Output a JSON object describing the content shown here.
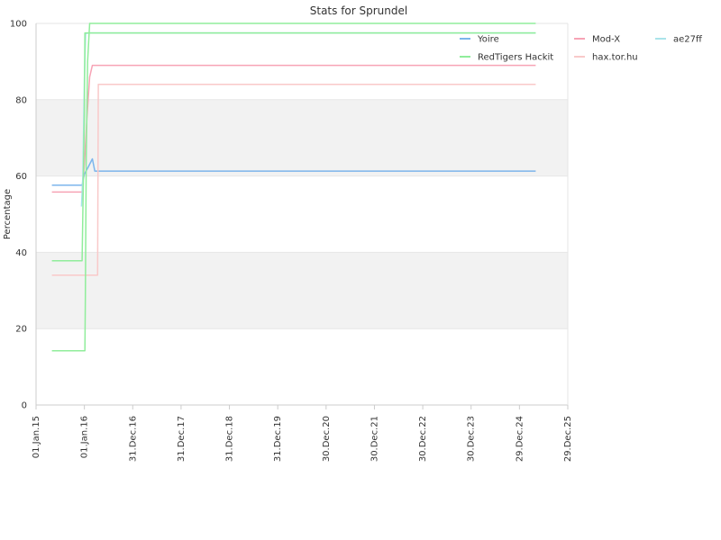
{
  "chart_data": {
    "type": "line",
    "title": "Stats for Sprundel",
    "xlabel": "",
    "ylabel": "Percentage",
    "x_type": "date",
    "xlim": [
      "2015-01-01",
      "2025-12-29"
    ],
    "ylim": [
      0,
      100
    ],
    "y_ticks": [
      0,
      20,
      40,
      60,
      80,
      100
    ],
    "x_ticks": [
      {
        "date": "2015-01-01",
        "label": "01.Jan.15"
      },
      {
        "date": "2016-01-01",
        "label": "01.Jan.16"
      },
      {
        "date": "2016-12-31",
        "label": "31.Dec.16"
      },
      {
        "date": "2017-12-31",
        "label": "31.Dec.17"
      },
      {
        "date": "2018-12-31",
        "label": "31.Dec.18"
      },
      {
        "date": "2019-12-31",
        "label": "31.Dec.19"
      },
      {
        "date": "2020-12-30",
        "label": "30.Dec.20"
      },
      {
        "date": "2021-12-30",
        "label": "30.Dec.21"
      },
      {
        "date": "2022-12-30",
        "label": "30.Dec.22"
      },
      {
        "date": "2023-12-30",
        "label": "30.Dec.23"
      },
      {
        "date": "2024-12-29",
        "label": "29.Dec.24"
      },
      {
        "date": "2025-12-29",
        "label": "29.Dec.25"
      }
    ],
    "grid": true,
    "alternating_bands": true,
    "legend_position": "top-right",
    "series": [
      {
        "name": "Yoire",
        "color": "#7cb5ec",
        "points": [
          [
            "2015-05-01",
            57.6
          ],
          [
            "2015-12-15",
            57.6
          ],
          [
            "2016-01-01",
            60.5
          ],
          [
            "2016-02-01",
            62.5
          ],
          [
            "2016-03-01",
            64.5
          ],
          [
            "2016-03-20",
            61.3
          ],
          [
            "2025-05-01",
            61.3
          ]
        ]
      },
      {
        "name": "Mod-X",
        "color": "#f7a3b5",
        "points": [
          [
            "2015-05-01",
            55.8
          ],
          [
            "2015-12-15",
            55.8
          ],
          [
            "2016-01-01",
            63
          ],
          [
            "2016-01-20",
            75
          ],
          [
            "2016-02-10",
            86
          ],
          [
            "2016-03-01",
            89
          ],
          [
            "2025-05-01",
            89
          ]
        ]
      },
      {
        "name": "ae27ff",
        "color": "#a9e4ea",
        "points": [
          [
            "2015-12-10",
            52
          ],
          [
            "2015-12-20",
            60
          ],
          [
            "2016-01-01",
            85
          ],
          [
            "2016-01-10",
            97.3
          ],
          [
            "2016-02-01",
            97.5
          ],
          [
            "2025-05-01",
            97.5
          ]
        ]
      },
      {
        "name": "RedTigers Hackit",
        "color": "#90ed9b",
        "points": [
          [
            "2015-05-01",
            37.8
          ],
          [
            "2015-12-15",
            37.8
          ],
          [
            "2016-01-01",
            76
          ],
          [
            "2016-01-05",
            97.5
          ],
          [
            "2016-02-01",
            97.5
          ],
          [
            "2025-05-01",
            97.5
          ]
        ]
      },
      {
        "name": "hax.tor.hu",
        "color": "#f9c9c9",
        "points": [
          [
            "2015-05-01",
            34
          ],
          [
            "2016-04-10",
            34
          ],
          [
            "2016-04-15",
            84
          ],
          [
            "2025-05-01",
            84
          ]
        ]
      },
      {
        "name": "RedTigers Hackit",
        "color": "#90ed9b",
        "points": [
          [
            "2015-05-01",
            14.2
          ],
          [
            "2016-01-05",
            14.2
          ],
          [
            "2016-01-08",
            28
          ],
          [
            "2016-01-15",
            65
          ],
          [
            "2016-01-25",
            90
          ],
          [
            "2016-02-10",
            100
          ],
          [
            "2025-05-01",
            100
          ]
        ]
      }
    ],
    "legend": [
      {
        "name": "Yoire",
        "color": "#7cb5ec"
      },
      {
        "name": "Mod-X",
        "color": "#f7a3b5"
      },
      {
        "name": "ae27ff",
        "color": "#a9e4ea"
      },
      {
        "name": "RedTigers Hackit",
        "color": "#90ed9b"
      },
      {
        "name": "hax.tor.hu",
        "color": "#f9c9c9"
      }
    ]
  }
}
